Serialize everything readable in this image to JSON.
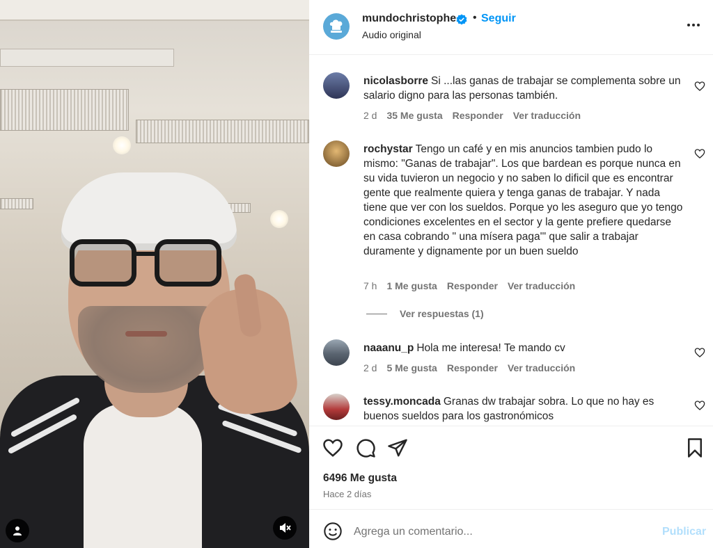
{
  "post": {
    "username": "mundochristophe",
    "follow_label": "Seguir",
    "separator": "•",
    "audio": "Audio original",
    "likes": "6496 Me gusta",
    "time": "Hace 2 días"
  },
  "comments": [
    {
      "username": "nicolasborre",
      "text": "Si ...las ganas de trabajar se complementa sobre un salario digno para las personas también.",
      "age": "2 d",
      "likes": "35 Me gusta",
      "reply": "Responder",
      "translate": "Ver traducción"
    },
    {
      "username": "rochystar",
      "text": "Tengo un café y en mis anuncios tambien pudo lo mismo: \"Ganas de trabajar\". Los que bardean es porque nunca en su vida tuvieron un negocio y no saben lo dificil que es encontrar gente que realmente quiera y tenga ganas de trabajar. Y nada tiene que ver con los sueldos. Porque yo les aseguro que yo tengo condiciones excelentes en el sector y la gente prefiere quedarse en casa cobrando \" una mísera paga'\" que salir a trabajar duramente y dignamente por un buen sueldo",
      "age": "7 h",
      "likes": "1 Me gusta",
      "reply": "Responder",
      "translate": "Ver traducción",
      "view_replies": "Ver respuestas (1)"
    },
    {
      "username": "naaanu_p",
      "text": "Hola me interesa! Te mando cv",
      "age": "2 d",
      "likes": "5 Me gusta",
      "reply": "Responder",
      "translate": "Ver traducción"
    },
    {
      "username": "tessy.moncada",
      "text": "Granas dw trabajar sobra. Lo que no hay es buenos sueldos para los gastronómicos"
    }
  ],
  "composer": {
    "placeholder": "Agrega un comentario...",
    "publish_label": "Publicar"
  },
  "colors": {
    "accent": "#0095f6",
    "publish_disabled": "#b2dffc",
    "secondary_text": "#737373"
  }
}
